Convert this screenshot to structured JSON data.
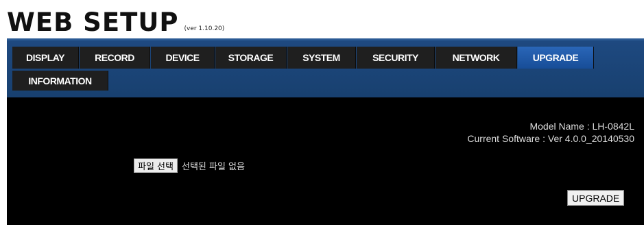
{
  "header": {
    "title": "WEB SETUP",
    "version": "(ver 1.10.20)"
  },
  "tabs": {
    "items": [
      {
        "label": "DISPLAY",
        "active": false
      },
      {
        "label": "RECORD",
        "active": false
      },
      {
        "label": "DEVICE",
        "active": false
      },
      {
        "label": "STORAGE",
        "active": false
      },
      {
        "label": "SYSTEM",
        "active": false
      },
      {
        "label": "SECURITY",
        "active": false
      },
      {
        "label": "NETWORK",
        "active": false
      },
      {
        "label": "UPGRADE",
        "active": true
      },
      {
        "label": "INFORMATION",
        "active": false
      }
    ]
  },
  "upgrade": {
    "model_name": "Model Name : LH-0842L",
    "current_software": "Current Software : Ver 4.0.0_20140530",
    "file_button_label": "파일 선택",
    "file_status": "선택된 파일 없음",
    "upgrade_button_label": "UPGRADE"
  },
  "colors": {
    "panel_background": "#000000",
    "tabbar_background": "#1e4980",
    "tab_background": "#1f1f1f",
    "active_tab_background": "#2a66b8"
  }
}
